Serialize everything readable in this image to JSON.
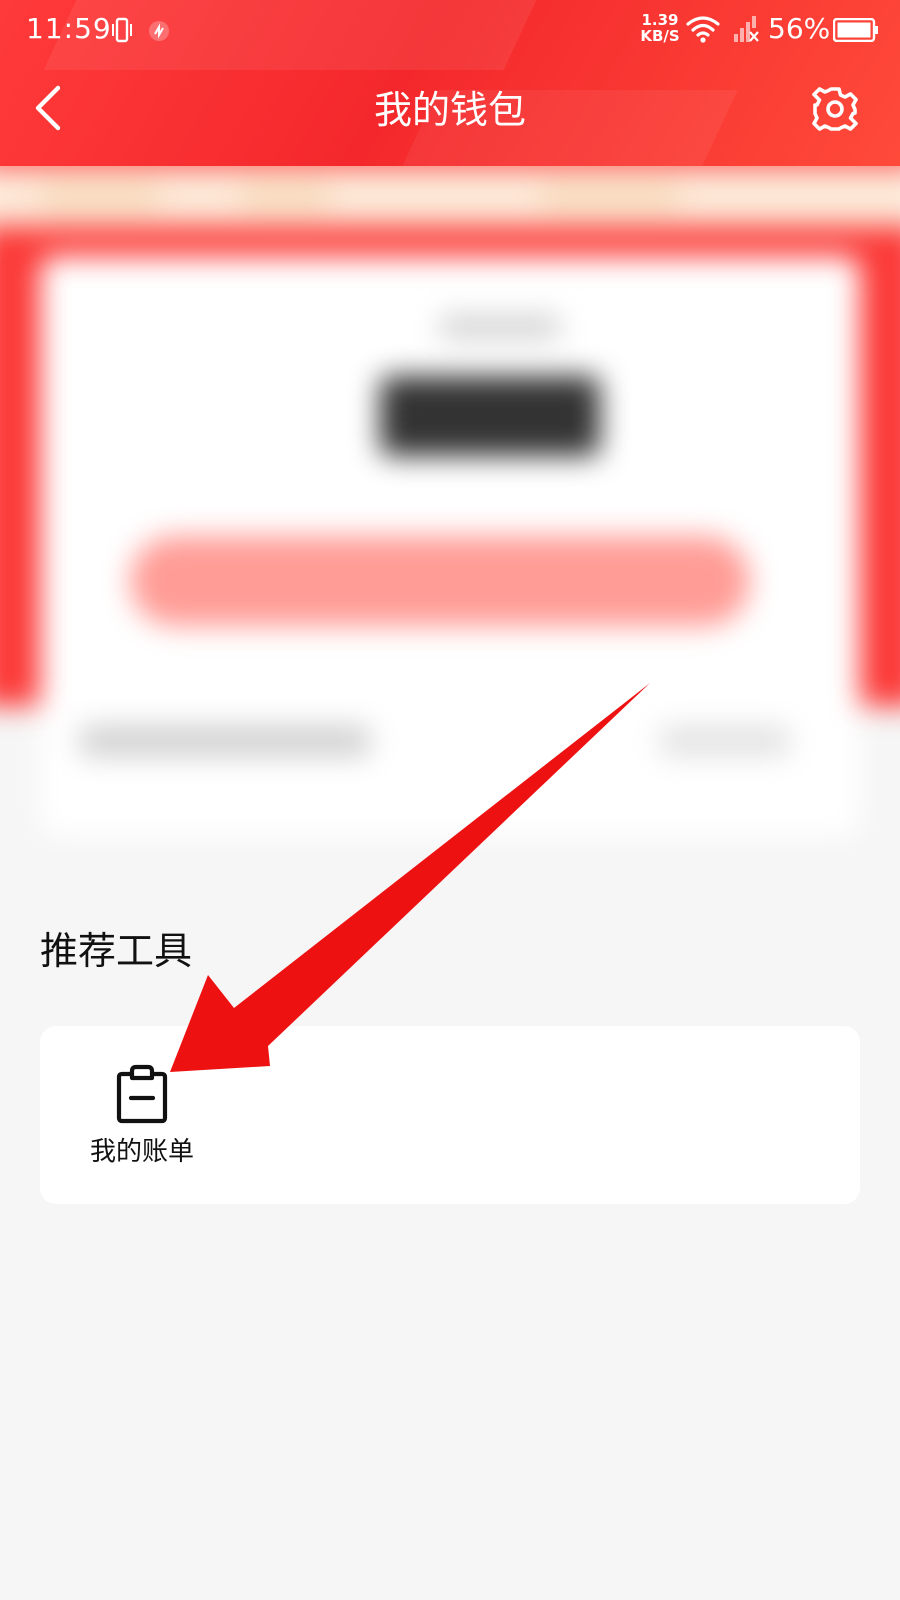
{
  "status_bar": {
    "time": "11:59",
    "net_speed_value": "1.39",
    "net_speed_unit": "KB/S",
    "battery": "56%"
  },
  "nav": {
    "title": "我的钱包",
    "back_icon": "chevron-left-icon",
    "settings_icon": "gear-icon"
  },
  "tools": {
    "section_title": "推荐工具",
    "items": [
      {
        "label": "我的账单",
        "icon": "clipboard-minus-icon"
      }
    ]
  },
  "colors": {
    "header_red": "#f4282c",
    "page_bg": "#f6f6f6",
    "card_bg": "#ffffff",
    "arrow_red": "#ee1111"
  }
}
